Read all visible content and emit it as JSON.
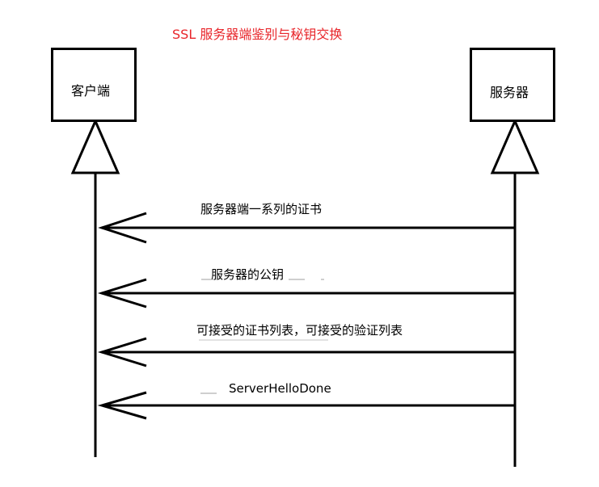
{
  "title": "SSL 服务器端鉴别与秘钥交换",
  "participants": {
    "client": "客户端",
    "server": "服务器"
  },
  "messages": [
    "服务器端一系列的证书",
    "服务器的公钥",
    "可接受的证书列表，可接受的验证列表",
    "ServerHelloDone"
  ],
  "colors": {
    "title": "#e8252a",
    "lines": "#000000",
    "background": "#ffffff"
  }
}
